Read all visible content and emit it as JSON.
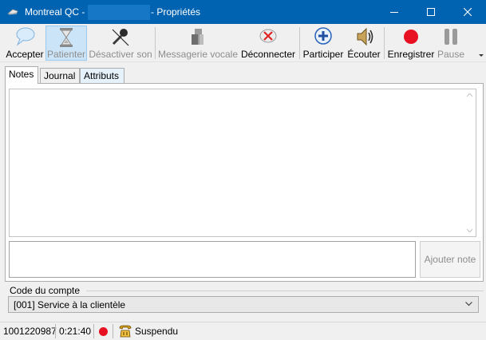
{
  "window": {
    "title_prefix": "Montreal QC -",
    "title_suffix": "- Propriétés",
    "controls": {
      "minimize": "minimize-icon",
      "maximize": "maximize-icon",
      "close": "close-icon"
    }
  },
  "toolbar": {
    "accept": "Accepter",
    "hold": "Patienter",
    "mute": "Désactiver son",
    "voicemail": "Messagerie vocale",
    "disconnect": "Déconnecter",
    "join": "Participer",
    "listen": "Écouter",
    "record": "Enregistrer",
    "pause": "Pause"
  },
  "tabs": {
    "notes": "Notes",
    "journal": "Journal",
    "attributes": "Attributs"
  },
  "notes": {
    "add_button": "Ajouter note"
  },
  "account": {
    "label": "Code du compte",
    "selected": "[001]  Service à la clientèle"
  },
  "status": {
    "id": "1001220987",
    "duration": "0:21:40",
    "state": "Suspendu"
  },
  "colors": {
    "titlebar": "#0063b1",
    "record": "#e81123",
    "accent": "#0078d7"
  }
}
